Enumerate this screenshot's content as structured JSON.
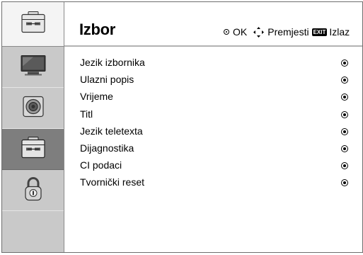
{
  "header": {
    "title": "Izbor",
    "hint_ok": "OK",
    "hint_move": "Premjesti",
    "hint_exit_badge": "EXIT",
    "hint_exit": "Izlaz"
  },
  "sidebar": {
    "items": [
      {
        "icon": "picture-icon",
        "active": false
      },
      {
        "icon": "audio-icon",
        "active": false
      },
      {
        "icon": "options-icon",
        "active": true
      },
      {
        "icon": "lock-icon",
        "active": false
      }
    ]
  },
  "menu": {
    "items": [
      {
        "label": "Jezik izbornika"
      },
      {
        "label": "Ulazni popis"
      },
      {
        "label": "Vrijeme"
      },
      {
        "label": "Titl"
      },
      {
        "label": "Jezik teletexta"
      },
      {
        "label": "Dijagnostika"
      },
      {
        "label": "CI podaci"
      },
      {
        "label": "Tvornički reset"
      }
    ]
  },
  "colors": {
    "sidebar_bg": "#c9c9c9",
    "sidebar_active": "#7e7e7e",
    "header_bg": "#ffffff"
  }
}
